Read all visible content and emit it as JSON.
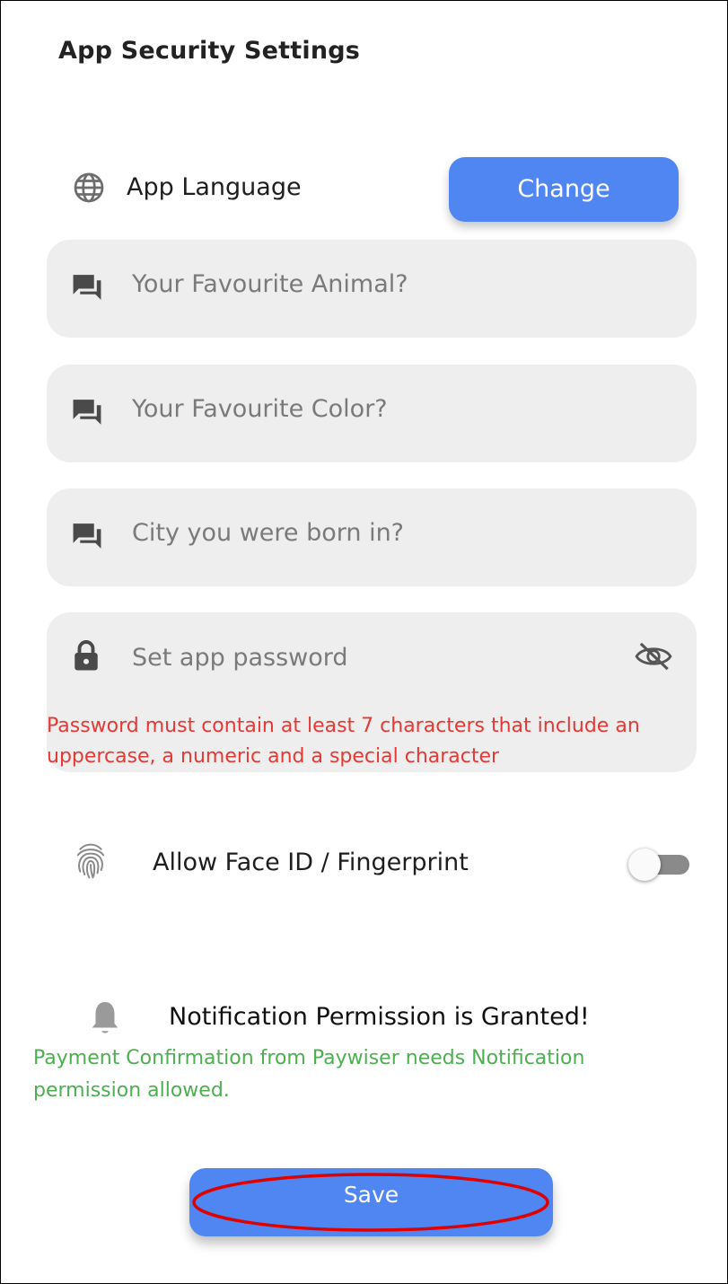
{
  "page": {
    "title": "App Security Settings"
  },
  "language": {
    "label": "App Language",
    "change_label": "Change",
    "icon": "globe-icon"
  },
  "fields": [
    {
      "placeholder": "Your Favourite Animal?",
      "icon": "chat-icon"
    },
    {
      "placeholder": "Your Favourite Color?",
      "icon": "chat-icon"
    },
    {
      "placeholder": "City you were born in?",
      "icon": "chat-icon"
    }
  ],
  "password": {
    "placeholder": "Set app password",
    "error": "Password must contain at least 7 characters that include an uppercase, a numeric and a special character",
    "icon": "lock-icon",
    "toggle_icon": "eye-off-icon"
  },
  "biometric": {
    "label": "Allow Face ID / Fingerprint",
    "enabled": false,
    "icon": "fingerprint-icon"
  },
  "notification": {
    "label": "Notification Permission is Granted!",
    "note": "Payment Confirmation from Paywiser needs Notification permission allowed.",
    "icon": "bell-icon"
  },
  "actions": {
    "save_label": "Save"
  },
  "colors": {
    "accent": "#4f86f2",
    "field_bg": "#eeeeee",
    "error": "#e53935",
    "success": "#4caf50",
    "highlight_ring": "#e00000"
  }
}
